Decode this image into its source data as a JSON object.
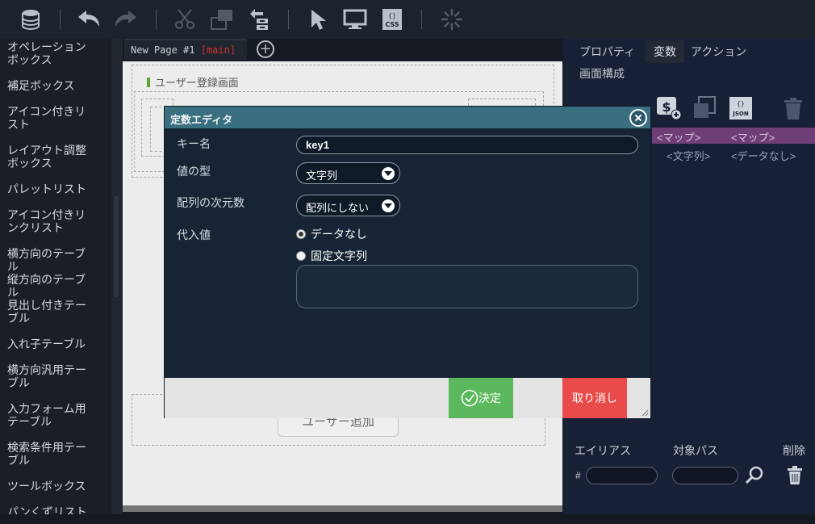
{
  "toolbar": {
    "icons": [
      "database-icon",
      "undo-icon",
      "redo-icon",
      "cut-icon",
      "copy-layout-icon",
      "upload-tree-icon",
      "select-pointer-icon",
      "monitor-icon",
      "css-icon",
      "loading-spinner-icon"
    ],
    "css_badge": "CSS"
  },
  "sidebar": {
    "items": [
      "オペレーションボックス",
      "補足ボックス",
      "アイコン付きリスト",
      "レイアウト調整ボックス",
      "パレットリスト",
      "アイコン付きリンクリスト",
      "横方向のテーブル",
      "縦方向のテーブル",
      "見出し付きテーブル",
      "入れ子テーブル",
      "横方向汎用テーブル",
      "入力フォーム用テーブル",
      "検索条件用テーブル",
      "ツールボックス",
      "パンくずリスト"
    ]
  },
  "canvas": {
    "tab_label": "New Page #1",
    "tab_branch": "[main]",
    "screen_label": "ユーザー登録画面",
    "add_user_button": "ユーザー追加"
  },
  "right_panel": {
    "tabs": [
      "プロパティ",
      "変数",
      "アクション",
      "画面構成"
    ],
    "active_tab": "変数",
    "row1": [
      "<マップ>",
      "<マップ>"
    ],
    "row2": [
      "<文字列>",
      "<データなし>"
    ],
    "json_badge": "JSON",
    "alias_header": "エイリアス",
    "path_header": "対象パス",
    "delete_header": "削除",
    "hash_prefix": "#"
  },
  "modal": {
    "title": "定数エディタ",
    "key_label": "キー名",
    "key_value": "key1",
    "type_label": "値の型",
    "type_value": "文字列",
    "dim_label": "配列の次元数",
    "dim_value": "配列にしない",
    "value_label": "代入値",
    "radio_none": "データなし",
    "radio_fixed": "固定文字列",
    "ok_label": "決定",
    "cancel_label": "取り消し"
  },
  "colors": {
    "modal_title_bg": "#3a6f80",
    "modal_body_bg": "#162435",
    "ok_green": "#5cb85c",
    "cancel_red": "#e94a4a",
    "map_row_purple": "#6f3d78"
  }
}
